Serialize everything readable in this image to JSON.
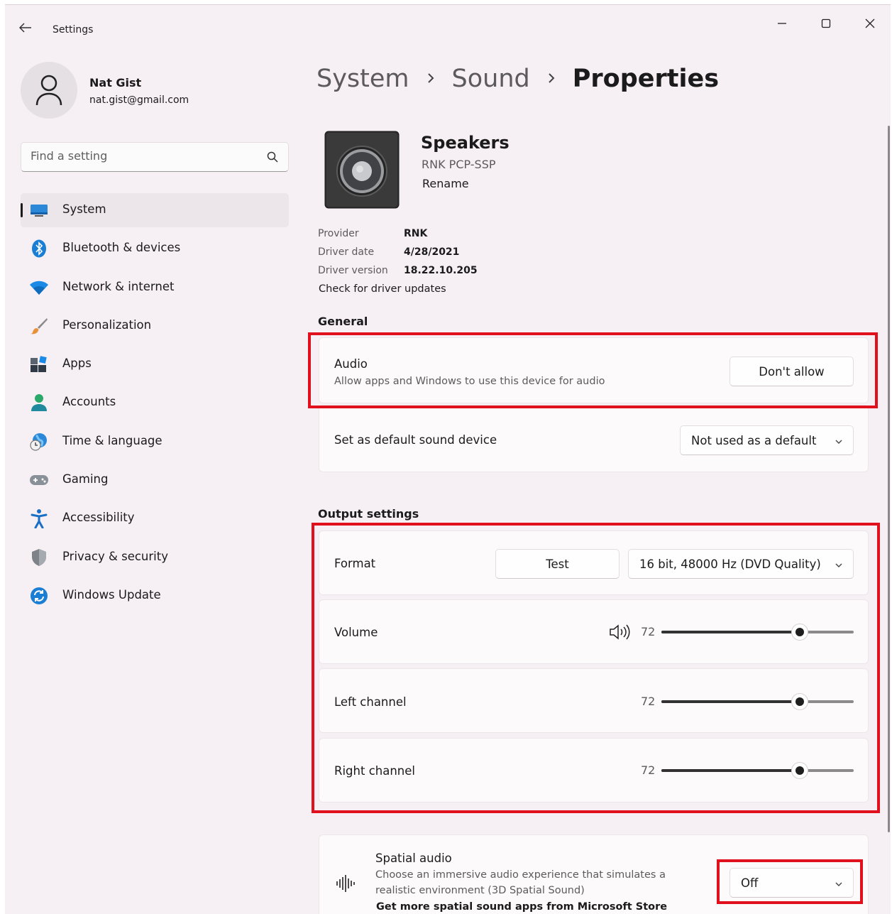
{
  "window": {
    "title": "Settings",
    "controls": {
      "minimize": "minimize-icon",
      "maximize": "maximize-icon",
      "close": "close-icon"
    }
  },
  "profile": {
    "name": "Nat Gist",
    "email": "nat.gist@gmail.com"
  },
  "search": {
    "placeholder": "Find a setting"
  },
  "sidebar": {
    "items": [
      {
        "label": "System",
        "icon": "system-icon",
        "active": true
      },
      {
        "label": "Bluetooth & devices",
        "icon": "bluetooth-icon"
      },
      {
        "label": "Network & internet",
        "icon": "wifi-icon"
      },
      {
        "label": "Personalization",
        "icon": "brush-icon"
      },
      {
        "label": "Apps",
        "icon": "apps-icon"
      },
      {
        "label": "Accounts",
        "icon": "person-icon"
      },
      {
        "label": "Time & language",
        "icon": "globe-clock-icon"
      },
      {
        "label": "Gaming",
        "icon": "gamepad-icon"
      },
      {
        "label": "Accessibility",
        "icon": "accessibility-icon"
      },
      {
        "label": "Privacy & security",
        "icon": "shield-icon"
      },
      {
        "label": "Windows Update",
        "icon": "update-icon"
      }
    ]
  },
  "breadcrumb": {
    "items": [
      "System",
      "Sound"
    ],
    "current": "Properties"
  },
  "device": {
    "name": "Speakers",
    "model": "RNK PCP-SSP",
    "rename": "Rename",
    "info": [
      {
        "key": "Provider",
        "value": "RNK"
      },
      {
        "key": "Driver date",
        "value": "4/28/2021"
      },
      {
        "key": "Driver version",
        "value": "18.22.10.205"
      }
    ],
    "check_updates": "Check for driver updates"
  },
  "general": {
    "title": "General",
    "audio": {
      "title": "Audio",
      "subtitle": "Allow apps and Windows to use this device for audio",
      "button": "Don't allow"
    },
    "default_device": {
      "title": "Set as default sound device",
      "value": "Not used as a default"
    }
  },
  "output": {
    "title": "Output settings",
    "format": {
      "label": "Format",
      "test_button": "Test",
      "value": "16 bit, 48000 Hz (DVD Quality)"
    },
    "volume": {
      "label": "Volume",
      "value": 72
    },
    "left_channel": {
      "label": "Left channel",
      "value": 72
    },
    "right_channel": {
      "label": "Right channel",
      "value": 72
    }
  },
  "spatial": {
    "title": "Spatial audio",
    "description_line1": "Choose an immersive audio experience that simulates a",
    "description_line2": "realistic environment (3D Spatial Sound)",
    "store_link": "Get more spatial sound apps from Microsoft Store",
    "value": "Off"
  },
  "highlight_color": "#e0101c"
}
